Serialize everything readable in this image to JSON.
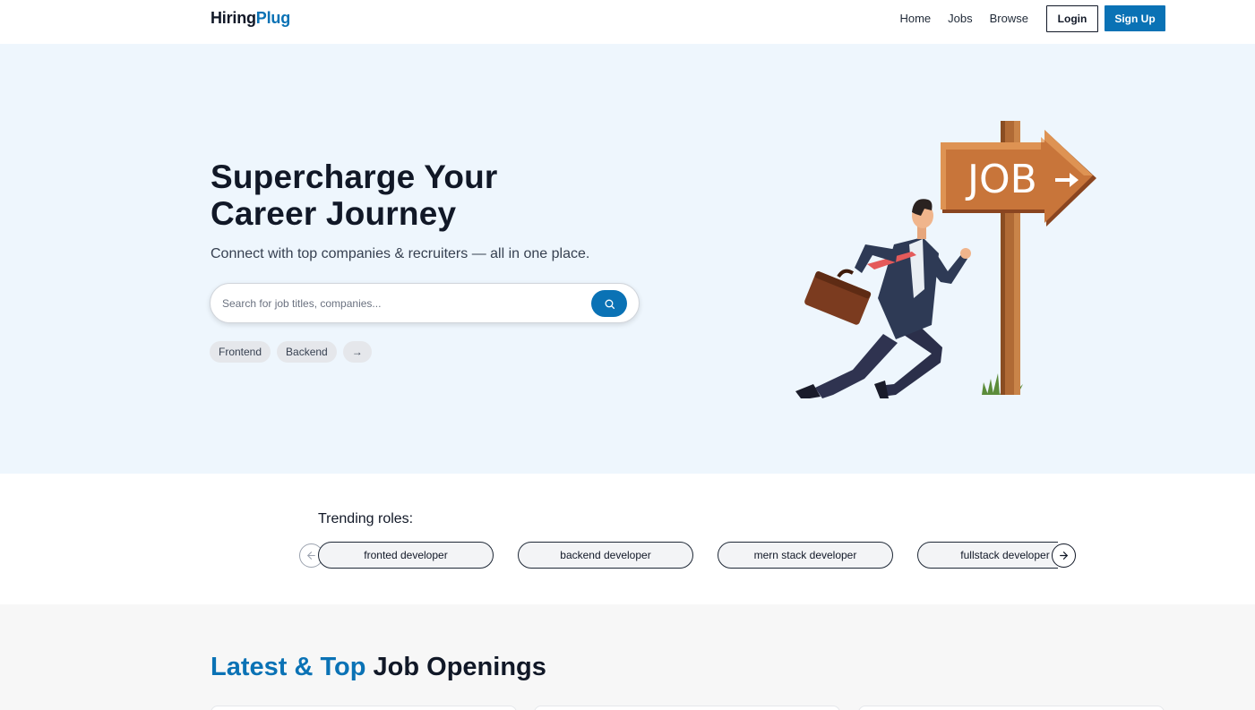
{
  "brand": {
    "part1": "Hiring",
    "part2": "Plug"
  },
  "nav": {
    "links": [
      "Home",
      "Jobs",
      "Browse"
    ],
    "login_label": "Login",
    "signup_label": "Sign Up"
  },
  "hero": {
    "title_line1": "Supercharge Your",
    "title_line2": "Career Journey",
    "subtitle": "Connect with top companies & recruiters — all in one place.",
    "search_placeholder": "Search for job titles, companies...",
    "tags": [
      "Frontend",
      "Backend",
      "→"
    ],
    "illustration_sign_text": "JOB"
  },
  "trending": {
    "title": "Trending roles:",
    "roles": [
      "fronted developer",
      "backend developer",
      "mern stack developer",
      "fullstack developer"
    ]
  },
  "latest": {
    "title_highlight": "Latest & Top",
    "title_rest": "Job Openings"
  },
  "colors": {
    "accent": "#0a72b5",
    "hero_bg": "#eef6fd",
    "section_bg": "#f7f7f7"
  },
  "icons": [
    "search-icon",
    "arrow-left-icon",
    "arrow-right-icon"
  ]
}
